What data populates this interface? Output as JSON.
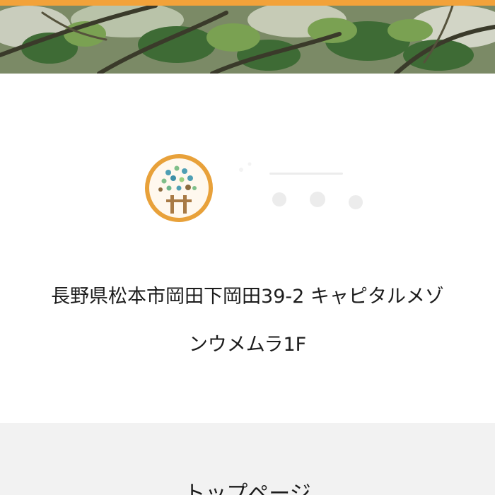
{
  "header": {
    "photo_icon": "leaves-photo",
    "accent_color": "#f2a23a"
  },
  "brand": {
    "logo_icon": "tree-circle-logo",
    "logo_ring_color": "#e8a13a"
  },
  "address": {
    "line1": "長野県松本市岡田下岡田39-2 キャピタルメゾ",
    "line2": "ンウメムラ1F"
  },
  "footer": {
    "top_page_link": "トップページ"
  }
}
